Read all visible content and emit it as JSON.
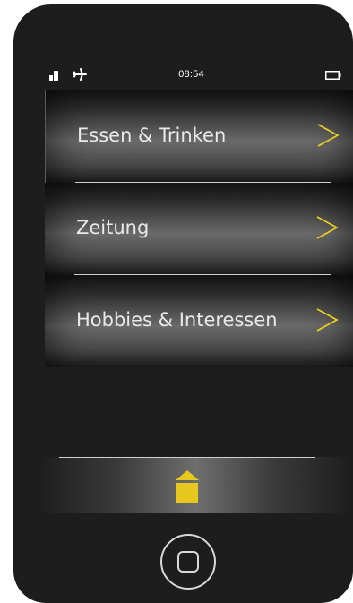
{
  "status_bar": {
    "time": "08:54",
    "signal_icon": "signal-bars-icon",
    "airplane_icon": "airplane-icon",
    "battery_icon": "battery-icon"
  },
  "menu": {
    "items": [
      {
        "label": "Essen & Trinken",
        "icon": "chevron-right-icon"
      },
      {
        "label": "Zeitung",
        "icon": "chevron-right-icon"
      },
      {
        "label": "Hobbies & Interessen",
        "icon": "chevron-right-icon"
      }
    ]
  },
  "navigation": {
    "up_icon": "arrow-up-icon",
    "home_icon": "home-button-icon"
  },
  "colors": {
    "accent": "#f0d21c",
    "up_icon": "#e6c81e",
    "phone_body": "#1d1d1d",
    "text": "#e9e9e9"
  }
}
